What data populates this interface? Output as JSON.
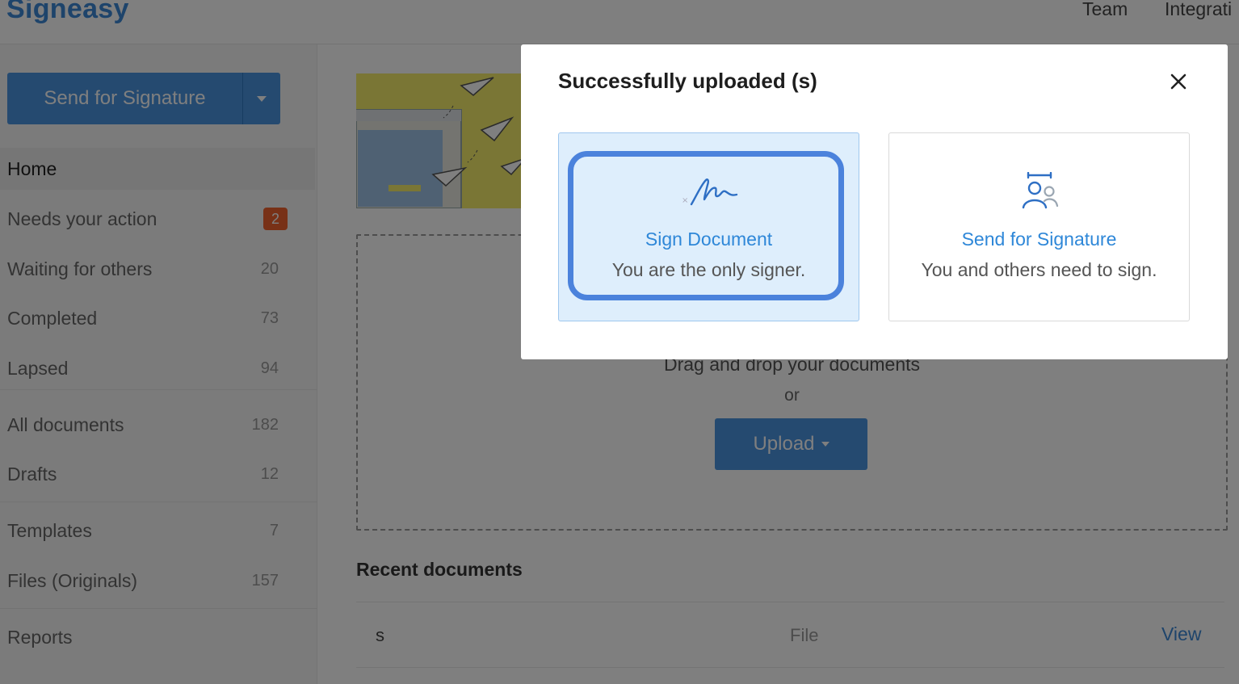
{
  "app": {
    "logo": "Signeasy",
    "nav": {
      "team": "Team",
      "integrations": "Integrati"
    }
  },
  "sidebar": {
    "send_button": "Send for Signature",
    "items": [
      {
        "label": "Home",
        "count": "",
        "active": true
      },
      {
        "label": "Needs your action",
        "count": "2",
        "badge": true
      },
      {
        "label": "Waiting for others",
        "count": "20"
      },
      {
        "label": "Completed",
        "count": "73"
      },
      {
        "label": "Lapsed",
        "count": "94"
      },
      {
        "label": "All documents",
        "count": "182"
      },
      {
        "label": "Drafts",
        "count": "12"
      },
      {
        "label": "Templates",
        "count": "7"
      },
      {
        "label": "Files (Originals)",
        "count": "157"
      },
      {
        "label": "Reports",
        "count": ""
      }
    ]
  },
  "main": {
    "dropzone": {
      "text": "Drag and drop your documents",
      "or": "or",
      "upload_button": "Upload"
    },
    "recent": {
      "title": "Recent documents",
      "rows": [
        {
          "name": "s",
          "type": "File",
          "action": "View"
        }
      ]
    }
  },
  "modal": {
    "title": "Successfully uploaded (s)",
    "options": [
      {
        "title": "Sign Document",
        "desc": "You are the only signer.",
        "selected": true
      },
      {
        "title": "Send for Signature",
        "desc": "You and others need to sign.",
        "selected": false
      }
    ]
  },
  "colors": {
    "accent": "#2e87d8",
    "primary_button": "#4a94e0",
    "badge": "#f0632e",
    "selected_bg": "#deeefc",
    "focus_ring": "#4b82dc"
  }
}
